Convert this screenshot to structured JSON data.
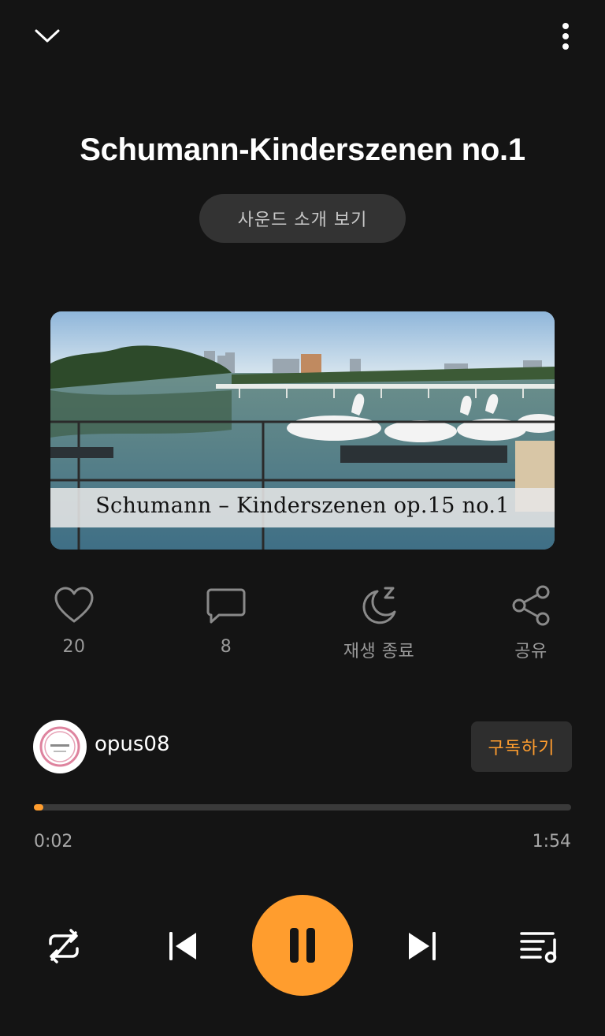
{
  "player": {
    "title": "Schumann-Kinderszenen no.1",
    "intro_button": "사운드 소개 보기",
    "cover_caption": "Schumann – Kinderszenen op.15 no.1",
    "colors": {
      "accent": "#ff9d2e",
      "background": "#141414",
      "muted": "#9a9a9a"
    }
  },
  "actions": [
    {
      "icon": "heart-icon",
      "label": "20"
    },
    {
      "icon": "comment-icon",
      "label": "8"
    },
    {
      "icon": "sleep-timer-icon",
      "label": "재생 종료"
    },
    {
      "icon": "share-icon",
      "label": "공유"
    }
  ],
  "channel": {
    "name": "opus08",
    "subscribe_label": "구독하기"
  },
  "playback": {
    "current_time": "0:02",
    "total_time": "1:54",
    "progress_fraction": 0.017
  },
  "controls": {
    "repeat": "repeat-icon",
    "previous": "skip-previous-icon",
    "play_pause": "pause-icon",
    "next": "skip-next-icon",
    "playlist": "playlist-icon"
  }
}
